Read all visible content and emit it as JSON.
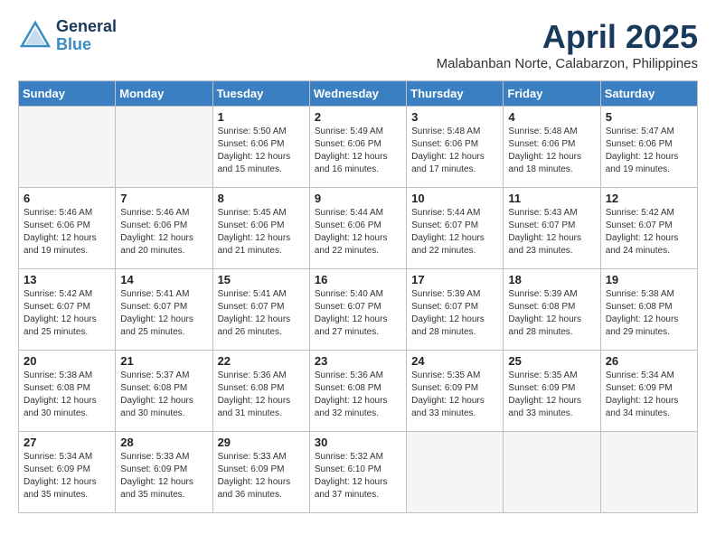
{
  "header": {
    "logo_general": "General",
    "logo_blue": "Blue",
    "month_title": "April 2025",
    "location": "Malabanban Norte, Calabarzon, Philippines"
  },
  "days_of_week": [
    "Sunday",
    "Monday",
    "Tuesday",
    "Wednesday",
    "Thursday",
    "Friday",
    "Saturday"
  ],
  "weeks": [
    [
      {
        "day": "",
        "info": ""
      },
      {
        "day": "",
        "info": ""
      },
      {
        "day": "1",
        "info": "Sunrise: 5:50 AM\nSunset: 6:06 PM\nDaylight: 12 hours\nand 15 minutes."
      },
      {
        "day": "2",
        "info": "Sunrise: 5:49 AM\nSunset: 6:06 PM\nDaylight: 12 hours\nand 16 minutes."
      },
      {
        "day": "3",
        "info": "Sunrise: 5:48 AM\nSunset: 6:06 PM\nDaylight: 12 hours\nand 17 minutes."
      },
      {
        "day": "4",
        "info": "Sunrise: 5:48 AM\nSunset: 6:06 PM\nDaylight: 12 hours\nand 18 minutes."
      },
      {
        "day": "5",
        "info": "Sunrise: 5:47 AM\nSunset: 6:06 PM\nDaylight: 12 hours\nand 19 minutes."
      }
    ],
    [
      {
        "day": "6",
        "info": "Sunrise: 5:46 AM\nSunset: 6:06 PM\nDaylight: 12 hours\nand 19 minutes."
      },
      {
        "day": "7",
        "info": "Sunrise: 5:46 AM\nSunset: 6:06 PM\nDaylight: 12 hours\nand 20 minutes."
      },
      {
        "day": "8",
        "info": "Sunrise: 5:45 AM\nSunset: 6:06 PM\nDaylight: 12 hours\nand 21 minutes."
      },
      {
        "day": "9",
        "info": "Sunrise: 5:44 AM\nSunset: 6:06 PM\nDaylight: 12 hours\nand 22 minutes."
      },
      {
        "day": "10",
        "info": "Sunrise: 5:44 AM\nSunset: 6:07 PM\nDaylight: 12 hours\nand 22 minutes."
      },
      {
        "day": "11",
        "info": "Sunrise: 5:43 AM\nSunset: 6:07 PM\nDaylight: 12 hours\nand 23 minutes."
      },
      {
        "day": "12",
        "info": "Sunrise: 5:42 AM\nSunset: 6:07 PM\nDaylight: 12 hours\nand 24 minutes."
      }
    ],
    [
      {
        "day": "13",
        "info": "Sunrise: 5:42 AM\nSunset: 6:07 PM\nDaylight: 12 hours\nand 25 minutes."
      },
      {
        "day": "14",
        "info": "Sunrise: 5:41 AM\nSunset: 6:07 PM\nDaylight: 12 hours\nand 25 minutes."
      },
      {
        "day": "15",
        "info": "Sunrise: 5:41 AM\nSunset: 6:07 PM\nDaylight: 12 hours\nand 26 minutes."
      },
      {
        "day": "16",
        "info": "Sunrise: 5:40 AM\nSunset: 6:07 PM\nDaylight: 12 hours\nand 27 minutes."
      },
      {
        "day": "17",
        "info": "Sunrise: 5:39 AM\nSunset: 6:07 PM\nDaylight: 12 hours\nand 28 minutes."
      },
      {
        "day": "18",
        "info": "Sunrise: 5:39 AM\nSunset: 6:08 PM\nDaylight: 12 hours\nand 28 minutes."
      },
      {
        "day": "19",
        "info": "Sunrise: 5:38 AM\nSunset: 6:08 PM\nDaylight: 12 hours\nand 29 minutes."
      }
    ],
    [
      {
        "day": "20",
        "info": "Sunrise: 5:38 AM\nSunset: 6:08 PM\nDaylight: 12 hours\nand 30 minutes."
      },
      {
        "day": "21",
        "info": "Sunrise: 5:37 AM\nSunset: 6:08 PM\nDaylight: 12 hours\nand 30 minutes."
      },
      {
        "day": "22",
        "info": "Sunrise: 5:36 AM\nSunset: 6:08 PM\nDaylight: 12 hours\nand 31 minutes."
      },
      {
        "day": "23",
        "info": "Sunrise: 5:36 AM\nSunset: 6:08 PM\nDaylight: 12 hours\nand 32 minutes."
      },
      {
        "day": "24",
        "info": "Sunrise: 5:35 AM\nSunset: 6:09 PM\nDaylight: 12 hours\nand 33 minutes."
      },
      {
        "day": "25",
        "info": "Sunrise: 5:35 AM\nSunset: 6:09 PM\nDaylight: 12 hours\nand 33 minutes."
      },
      {
        "day": "26",
        "info": "Sunrise: 5:34 AM\nSunset: 6:09 PM\nDaylight: 12 hours\nand 34 minutes."
      }
    ],
    [
      {
        "day": "27",
        "info": "Sunrise: 5:34 AM\nSunset: 6:09 PM\nDaylight: 12 hours\nand 35 minutes."
      },
      {
        "day": "28",
        "info": "Sunrise: 5:33 AM\nSunset: 6:09 PM\nDaylight: 12 hours\nand 35 minutes."
      },
      {
        "day": "29",
        "info": "Sunrise: 5:33 AM\nSunset: 6:09 PM\nDaylight: 12 hours\nand 36 minutes."
      },
      {
        "day": "30",
        "info": "Sunrise: 5:32 AM\nSunset: 6:10 PM\nDaylight: 12 hours\nand 37 minutes."
      },
      {
        "day": "",
        "info": ""
      },
      {
        "day": "",
        "info": ""
      },
      {
        "day": "",
        "info": ""
      }
    ]
  ]
}
